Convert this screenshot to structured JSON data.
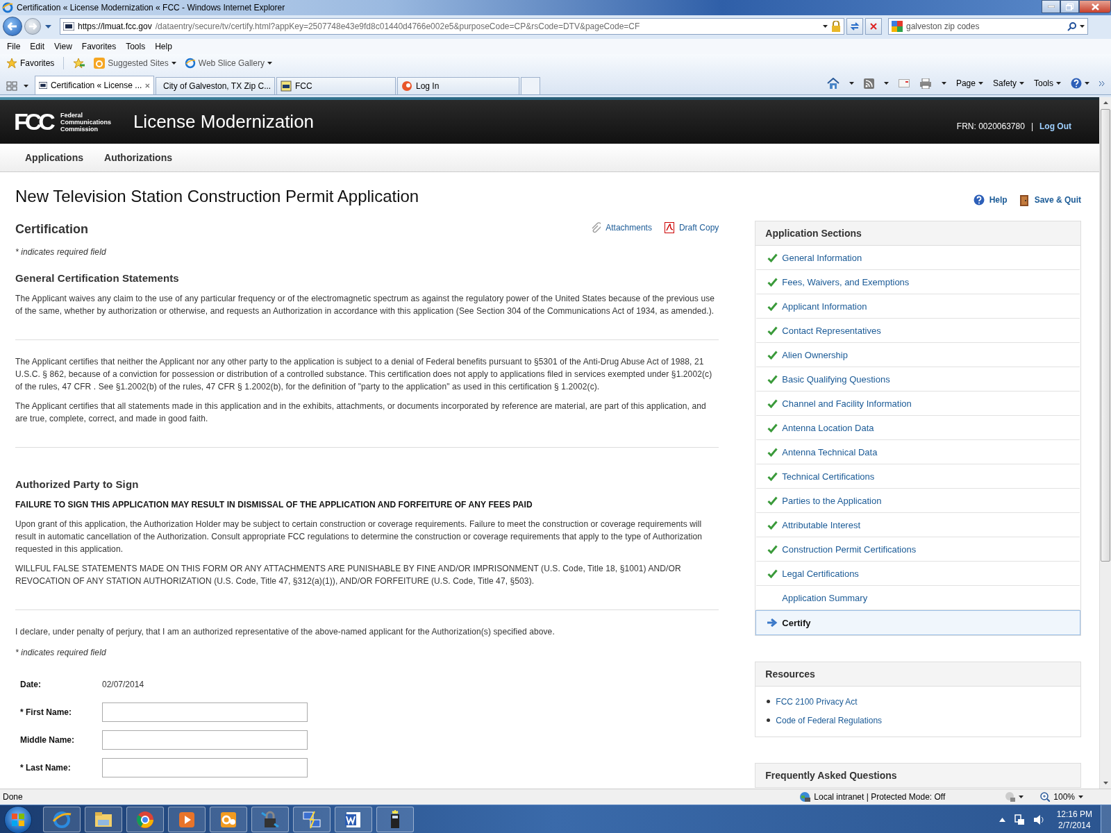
{
  "window": {
    "title": "Certification « License Modernization « FCC - Windows Internet Explorer"
  },
  "address_bar": {
    "host": "https://lmuat.fcc.gov",
    "path": "/dataentry/secure/tv/certify.html?appKey=2507748e43e9fd8c01440d4766e002e5&purposeCode=CP&rsCode=DTV&pageCode=CF"
  },
  "search_box": {
    "value": "galveston zip codes"
  },
  "menu_bar": [
    "File",
    "Edit",
    "View",
    "Favorites",
    "Tools",
    "Help"
  ],
  "favorites_bar": {
    "label": "Favorites",
    "links": [
      "Suggested Sites",
      "Web Slice Gallery"
    ]
  },
  "tabs": [
    {
      "label": "Certification « License ...",
      "selected": true
    },
    {
      "label": "City of Galveston, TX Zip C...",
      "selected": false
    },
    {
      "label": "FCC",
      "selected": false
    },
    {
      "label": "Log In",
      "selected": false
    }
  ],
  "command_bar": [
    "Page",
    "Safety",
    "Tools"
  ],
  "site_header": {
    "logo": "FCC",
    "agency": [
      "Federal",
      "Communications",
      "Commission"
    ],
    "title": "License Modernization",
    "frn": "FRN: 0020063780",
    "separator": "|",
    "logout": "Log Out"
  },
  "nav": [
    "Applications",
    "Authorizations"
  ],
  "page": {
    "title": "New Television Station Construction Permit Application",
    "help": "Help",
    "save_quit": "Save & Quit"
  },
  "certification": {
    "heading": "Certification",
    "attachments": "Attachments",
    "draft_copy": "Draft Copy",
    "blocks": [
      {
        "kind": "note",
        "text": "* indicates required field"
      },
      {
        "kind": "subheading",
        "text": "General Certification Statements"
      },
      {
        "kind": "paragraph",
        "text": "The Applicant waives any claim to the use of any particular frequency or of the electromagnetic spectrum as against the regulatory power of the United States because of the previous use of the same, whether by authorization or otherwise, and requests an Authorization in accordance with this application (See Section 304 of the Communications Act of 1934, as amended.)."
      },
      {
        "kind": "rule"
      },
      {
        "kind": "paragraph",
        "text": "The Applicant certifies that neither the Applicant nor any other party to the application is subject to a denial of Federal benefits pursuant to §5301 of the Anti-Drug Abuse Act of 1988, 21 U.S.C. § 862, because of a conviction for possession or distribution of a controlled substance. This certification does not apply to applications filed in services exempted under §1.2002(c) of the rules, 47 CFR . See §1.2002(b) of the rules, 47 CFR § 1.2002(b), for the definition of \"party to the application\" as used in this certification § 1.2002(c)."
      },
      {
        "kind": "paragraph",
        "text": "The Applicant certifies that all statements made in this application and in the exhibits, attachments, or documents incorporated by reference are material, are part of this application, and are true, complete, correct, and made in good faith."
      },
      {
        "kind": "rule"
      },
      {
        "kind": "subheading",
        "text": "Authorized Party to Sign"
      },
      {
        "kind": "warning",
        "text": "FAILURE TO SIGN THIS APPLICATION MAY RESULT IN DISMISSAL OF THE APPLICATION AND FORFEITURE OF ANY FEES PAID"
      },
      {
        "kind": "paragraph",
        "text": "Upon grant of this application, the Authorization Holder may be subject to certain construction or coverage requirements. Failure to meet the construction or coverage requirements will result in automatic cancellation of the Authorization. Consult appropriate FCC regulations to determine the construction or coverage requirements that apply to the type of Authorization requested in this application."
      },
      {
        "kind": "paragraph",
        "text": "WILLFUL FALSE STATEMENTS MADE ON THIS FORM OR ANY ATTACHMENTS ARE PUNISHABLE BY FINE AND/OR IMPRISONMENT (U.S. Code, Title 18, §1001) AND/OR REVOCATION OF ANY STATION AUTHORIZATION (U.S. Code, Title 47, §312(a)(1)), AND/OR FORFEITURE (U.S. Code, Title 47, §503)."
      },
      {
        "kind": "rule"
      },
      {
        "kind": "paragraph",
        "text": "I declare, under penalty of perjury, that I am an authorized representative of the above-named applicant for the Authorization(s) specified above."
      },
      {
        "kind": "note",
        "text": "* indicates required field"
      }
    ]
  },
  "form": {
    "date_label": "Date:",
    "date_value": "02/07/2014",
    "fields": [
      {
        "label": "* First Name:"
      },
      {
        "label": "Middle Name:"
      },
      {
        "label": "* Last Name:"
      }
    ]
  },
  "sidebar": {
    "heading": "Application Sections",
    "sections": [
      {
        "label": "General Information",
        "checked": true,
        "selected": false
      },
      {
        "label": "Fees, Waivers, and Exemptions",
        "checked": true,
        "selected": false
      },
      {
        "label": "Applicant Information",
        "checked": true,
        "selected": false
      },
      {
        "label": "Contact Representatives",
        "checked": true,
        "selected": false
      },
      {
        "label": "Alien Ownership",
        "checked": true,
        "selected": false
      },
      {
        "label": "Basic Qualifying Questions",
        "checked": true,
        "selected": false
      },
      {
        "label": "Channel and Facility Information",
        "checked": true,
        "selected": false
      },
      {
        "label": "Antenna Location Data",
        "checked": true,
        "selected": false
      },
      {
        "label": "Antenna Technical Data",
        "checked": true,
        "selected": false
      },
      {
        "label": "Technical Certifications",
        "checked": true,
        "selected": false
      },
      {
        "label": "Parties to the Application",
        "checked": true,
        "selected": false
      },
      {
        "label": "Attributable Interest",
        "checked": true,
        "selected": false
      },
      {
        "label": "Construction Permit Certifications",
        "checked": true,
        "selected": false
      },
      {
        "label": "Legal Certifications",
        "checked": true,
        "selected": false
      },
      {
        "label": "Application Summary",
        "checked": false,
        "selected": false
      },
      {
        "label": "Certify",
        "checked": false,
        "selected": true
      }
    ]
  },
  "resources": {
    "heading": "Resources",
    "links": [
      "FCC 2100 Privacy Act",
      "Code of Federal Regulations"
    ]
  },
  "faq": {
    "heading": "Frequently Asked Questions"
  },
  "status_bar": {
    "status": "Done",
    "zone": "Local intranet | Protected Mode: Off",
    "zoom": "100%"
  },
  "taskbar": {
    "time": "12:16 PM",
    "date": "2/7/2014"
  }
}
